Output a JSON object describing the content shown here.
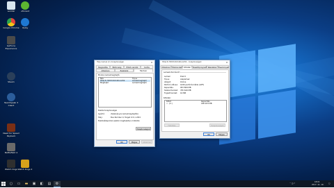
{
  "desktop_icons": [
    {
      "label": "Lomtár",
      "icon": "recycle-bin-icon",
      "color": "#d8e6f0"
    },
    {
      "label": "uTorrent",
      "icon": "utorrent-icon",
      "color": "#5cb531"
    },
    {
      "label": "Google Chrome",
      "icon": "chrome-icon",
      "color": "#e2443a"
    },
    {
      "label": "Uplay",
      "icon": "uplay-icon",
      "color": "#1e78d2"
    },
    {
      "label": "GeForce Experience",
      "icon": "geforce-icon",
      "color": "#4a4a4a"
    },
    {
      "label": "Steam",
      "icon": "steam-icon",
      "color": "#2a3f5a"
    },
    {
      "label": "TeamSpeak 3 Client",
      "icon": "teamspeak-icon",
      "color": "#2b5d9b"
    },
    {
      "label": "Need for Speed Payback",
      "icon": "game-icon",
      "color": "#7a2f15"
    },
    {
      "label": "Battlefield 4",
      "icon": "battlefield-icon",
      "color": "#6a6a6a"
    },
    {
      "label": "Watch Dogs",
      "icon": "watchdogs-icon",
      "color": "#2f2f2f"
    },
    {
      "label": "Watch Dogs 2",
      "icon": "watchdogs2-icon",
      "color": "#d8a21b"
    }
  ],
  "window1": {
    "title": "Helyi lemez (C:) tulajdonságai",
    "tabs_row1": [
      "Megosztás",
      "Biztonság",
      "Előző verziók",
      "Kvóta"
    ],
    "tabs_row2": [
      "Általános",
      "Eszközök",
      "Hardver"
    ],
    "active_tab": "Hardver",
    "list_caption": "Minden lemezmeghajtó:",
    "columns": [
      "Név",
      "Típus"
    ],
    "rows": [
      {
        "name": "Hitachi HDS721010CLA332",
        "type": "Lemezmeghajtó"
      },
      {
        "name": "Meghajtó",
        "type": "Lemezmeghajtó"
      }
    ],
    "properties_caption": "Eszköz tulajdonságai",
    "props": [
      {
        "key": "Gyártó:",
        "value": "(Szabványos lemezmeghajtók)"
      },
      {
        "key": "Hely:",
        "value": "Bus Number 0, Target Id 0, LUN 0"
      },
      {
        "key": "Eszközállapot:",
        "value": "Az eszköz megfelelően működik."
      }
    ],
    "properties_button": "Tulajdonságok",
    "ok": "OK",
    "cancel": "Mégse",
    "apply": "Alkalmaz"
  },
  "window2": {
    "title": "Hitachi HDS721010CLA332 – tulajdonságok",
    "tabs": [
      "Általános",
      "Házirendek",
      "Kötetek",
      "Illesztőprogram",
      "Részletek",
      "Események"
    ],
    "active_tab": "Kötetek",
    "section1": "Lemezinformációk",
    "fields": [
      {
        "key": "Lemez:",
        "value": "Disk 0"
      },
      {
        "key": "Típus:",
        "value": "Alaplemez"
      },
      {
        "key": "Állapot:",
        "value": "Online"
      },
      {
        "key": "Partíció stílusa:",
        "value": "GUID-partíciós tábla (GPT)"
      },
      {
        "key": "Kapacitás:",
        "value": "953 869 MB"
      },
      {
        "key": "Szabad terület:",
        "value": "765 640 MB"
      },
      {
        "key": "Foglalt terület:",
        "value": "16 MB"
      }
    ],
    "section2": "Kötetek:",
    "vol_columns": [
      "Kötet",
      "Kapacitás"
    ],
    "volumes": [
      {
        "name": "(C:)",
        "capacity": "188 203 MB"
      }
    ],
    "populate_button": "Feltöltés",
    "properties_button": "Tulajdonságok",
    "ok": "OK",
    "cancel": "Mégse"
  },
  "taskbar": {
    "start_icon": "windows-start-icon",
    "time": "18:01",
    "date": "2017. 11. 19."
  }
}
